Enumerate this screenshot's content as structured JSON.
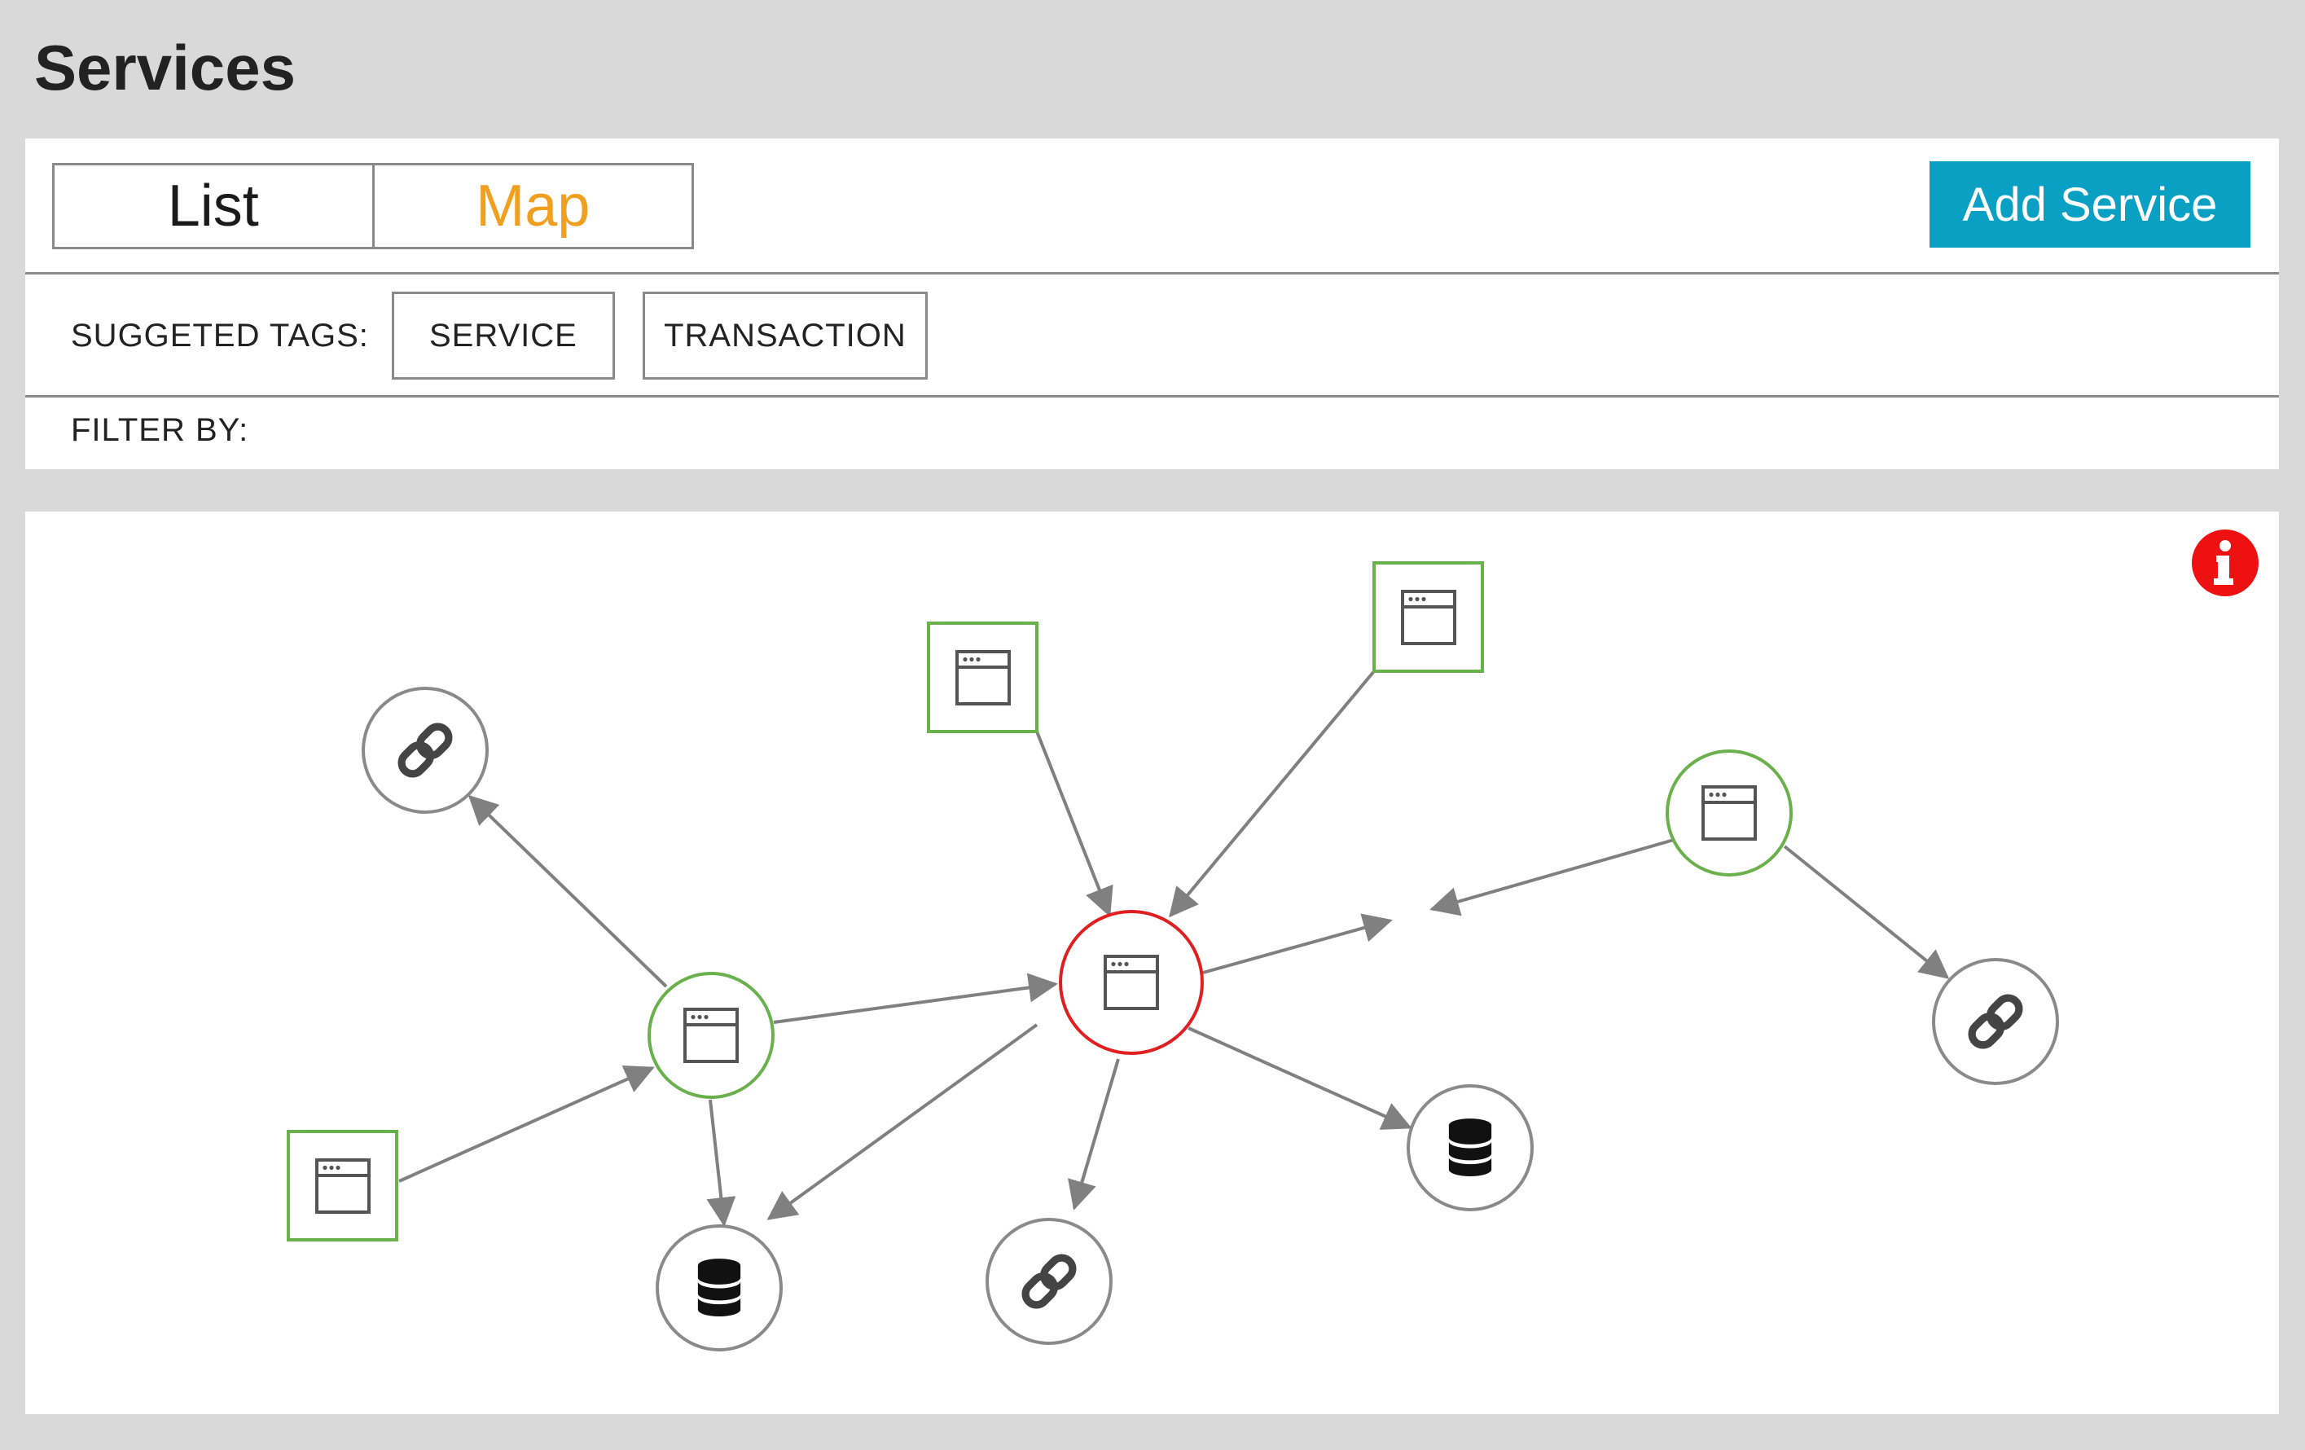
{
  "page": {
    "title": "Services"
  },
  "toolbar": {
    "tabs": [
      {
        "label": "List",
        "active": false
      },
      {
        "label": "Map",
        "active": true
      }
    ],
    "add_button": "Add Service"
  },
  "tags": {
    "label": "SUGGETED TAGS:",
    "items": [
      "SERVICE",
      "TRANSACTION"
    ]
  },
  "filter": {
    "label": "FILTER BY:"
  },
  "map": {
    "info_icon": "info-icon",
    "colors": {
      "healthy": "#6ab04c",
      "error": "#e02020",
      "neutral": "#8a8a8a",
      "edge": "#808080",
      "accent": "#f0a01e",
      "button": "#0aa0c4"
    },
    "nodes": [
      {
        "id": "web-top-left",
        "shape": "square",
        "icon": "window-icon",
        "status": "healthy"
      },
      {
        "id": "web-top-right",
        "shape": "square",
        "icon": "window-icon",
        "status": "healthy"
      },
      {
        "id": "web-bottom-left",
        "shape": "square",
        "icon": "window-icon",
        "status": "healthy"
      },
      {
        "id": "service-left",
        "shape": "circle",
        "icon": "window-icon",
        "status": "healthy"
      },
      {
        "id": "service-center",
        "shape": "circle",
        "icon": "window-icon",
        "status": "error"
      },
      {
        "id": "service-right",
        "shape": "circle",
        "icon": "window-icon",
        "status": "healthy"
      },
      {
        "id": "link-top-left",
        "shape": "circle",
        "icon": "link-icon",
        "status": "neutral"
      },
      {
        "id": "link-bottom",
        "shape": "circle",
        "icon": "link-icon",
        "status": "neutral"
      },
      {
        "id": "link-right",
        "shape": "circle",
        "icon": "link-icon",
        "status": "neutral"
      },
      {
        "id": "db-bottom-left",
        "shape": "circle",
        "icon": "database-icon",
        "status": "neutral"
      },
      {
        "id": "db-right",
        "shape": "circle",
        "icon": "database-icon",
        "status": "neutral"
      }
    ]
  }
}
